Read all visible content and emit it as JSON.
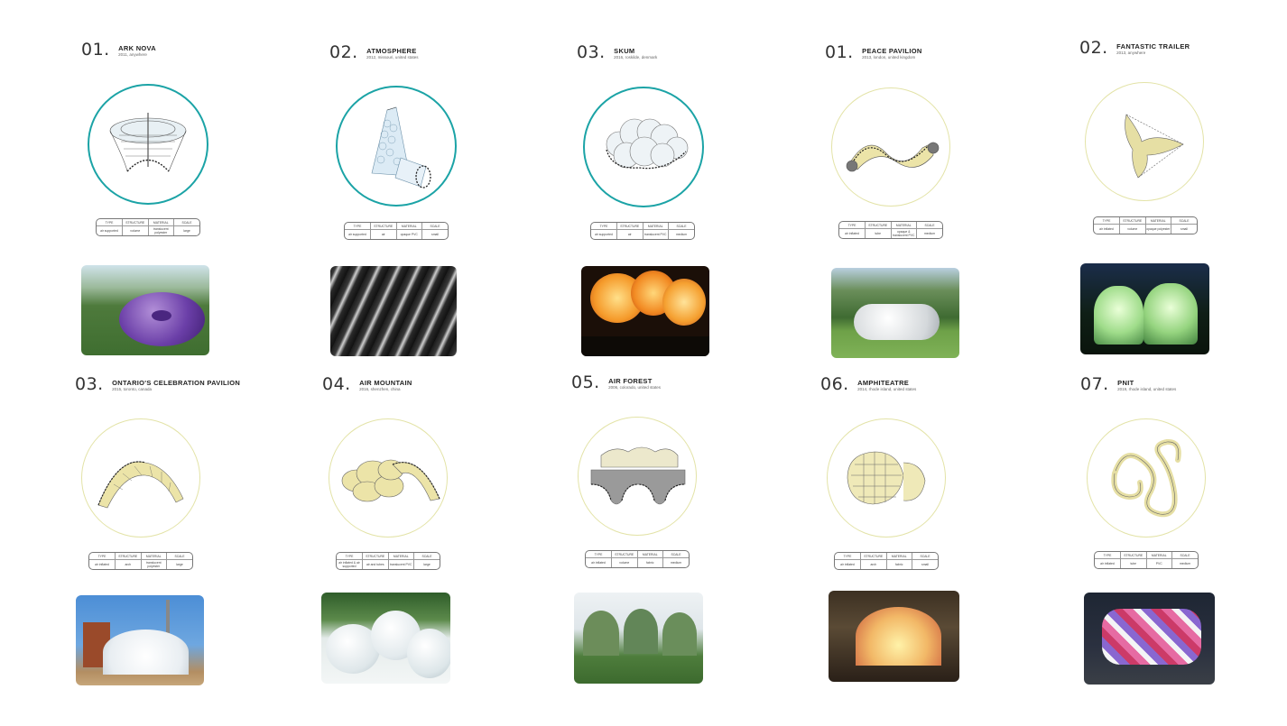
{
  "spec_headers": [
    "TYPE",
    "STRUCTURE",
    "MATERIAL",
    "SCALE"
  ],
  "projects": [
    {
      "num": "01.",
      "title": "ARK NOVA",
      "sub": "2011, anywhere",
      "circle": "teal",
      "icon": "ark-nova-drawing",
      "spec": [
        "air supported",
        "volume",
        "translucent polyester",
        "large"
      ]
    },
    {
      "num": "02.",
      "title": "ATMOSPHERE",
      "sub": "2012, missouri, united states",
      "circle": "teal",
      "icon": "atmosphere-drawing",
      "spec": [
        "air supported",
        "air",
        "opaque PVC",
        "small"
      ]
    },
    {
      "num": "03.",
      "title": "SKUM",
      "sub": "2016, roskilde, denmark",
      "circle": "teal",
      "icon": "skum-drawing",
      "spec": [
        "air supported",
        "air",
        "translucent PVC",
        "medium"
      ]
    },
    {
      "num": "01.",
      "title": "PEACE PAVILION",
      "sub": "2013, london, united kingdom",
      "circle": "yellow",
      "icon": "peace-pavilion-drawing",
      "spec": [
        "air inflated",
        "tube",
        "opaque & translucent PVC",
        "medium"
      ]
    },
    {
      "num": "02.",
      "title": "FANTASTIC TRAILER",
      "sub": "2013, anywhere",
      "circle": "yellow",
      "icon": "fantastic-trailer-drawing",
      "spec": [
        "air inflated",
        "volume",
        "opaque polyester",
        "small"
      ]
    },
    {
      "num": "03.",
      "title": "ONTARIO'S CELEBRATION PAVILION",
      "sub": "2015, toronto, canada",
      "circle": "yellow",
      "icon": "ontario-pavilion-drawing",
      "spec": [
        "air inflated",
        "arch",
        "translucent polyester",
        "large"
      ]
    },
    {
      "num": "04.",
      "title": "AIR MOUNTAIN",
      "sub": "2016, shenzhen, china",
      "circle": "yellow",
      "icon": "air-mountain-drawing",
      "spec": [
        "air inflated & air supported",
        "air and tubes",
        "translucent PVC",
        "large"
      ]
    },
    {
      "num": "05.",
      "title": "AIR FOREST",
      "sub": "2006, colorado, united states",
      "circle": "yellow",
      "icon": "air-forest-drawing",
      "spec": [
        "air inflated",
        "volume",
        "fabric",
        "medium"
      ]
    },
    {
      "num": "06.",
      "title": "AMPHITEATRE",
      "sub": "2014, rhode island, united states",
      "circle": "yellow",
      "icon": "amphiteatre-drawing",
      "spec": [
        "air inflated",
        "arch",
        "fabric",
        "small"
      ]
    },
    {
      "num": "07.",
      "title": "PNIT",
      "sub": "2019, rhode island, united states",
      "circle": "yellow",
      "icon": "pnit-drawing",
      "spec": [
        "air inflated",
        "tube",
        "PVC",
        "medium"
      ]
    }
  ]
}
